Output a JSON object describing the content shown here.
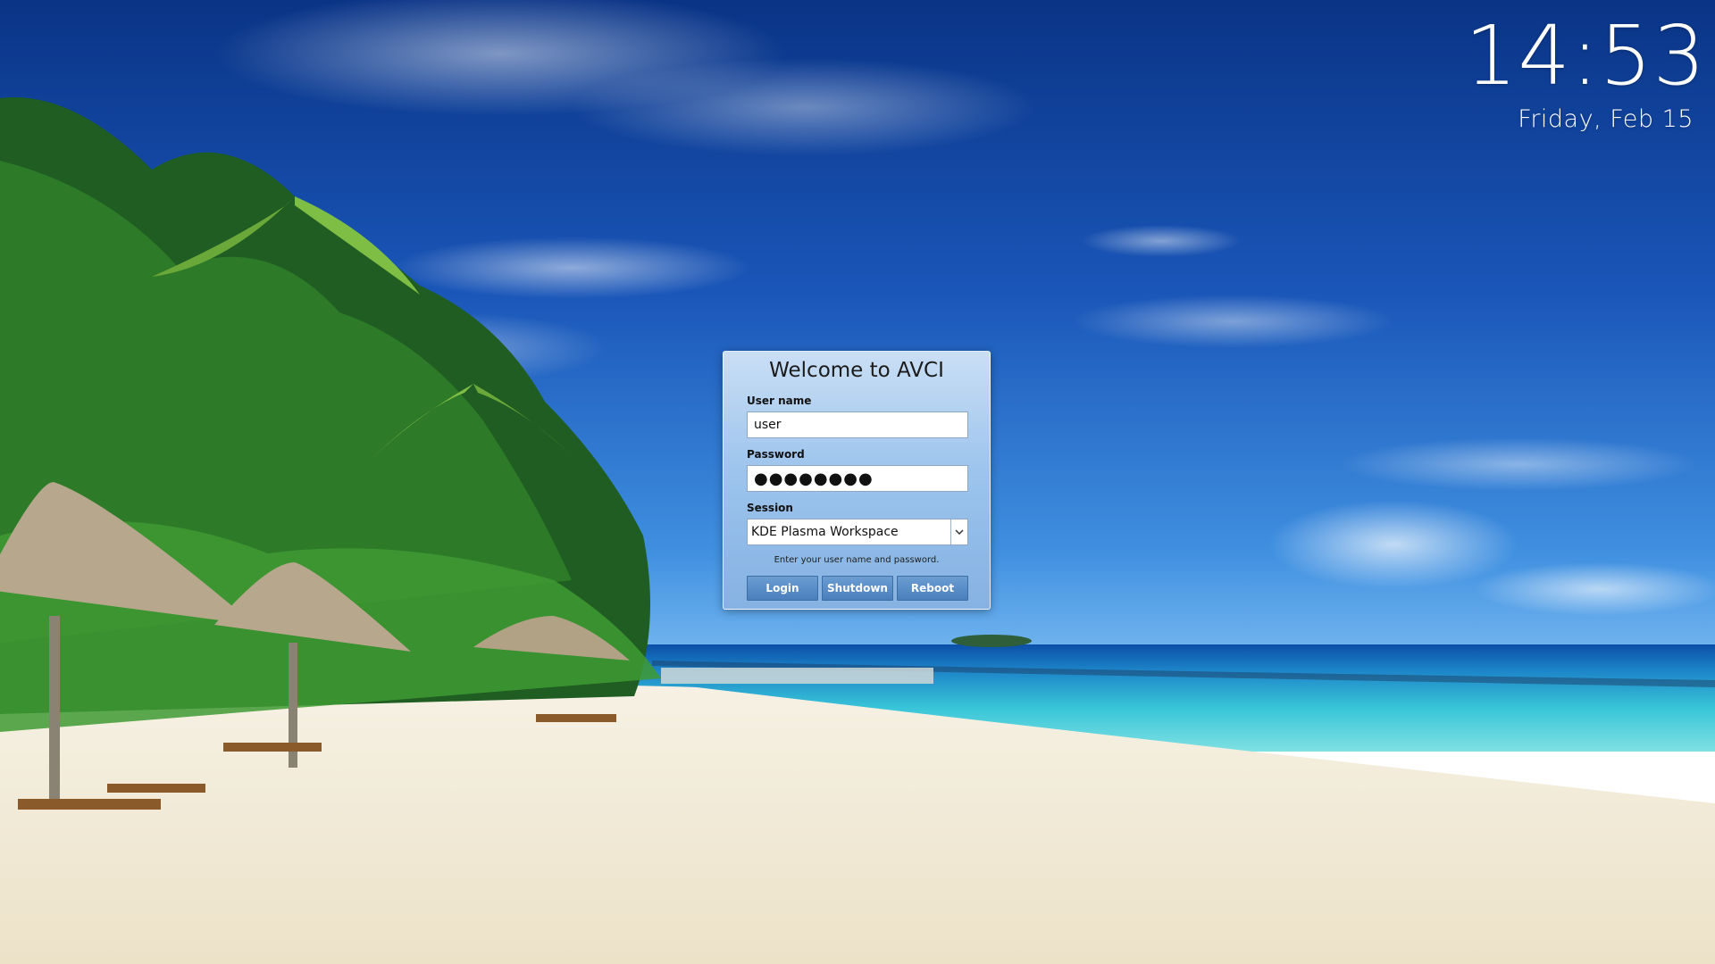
{
  "clock": {
    "time": "14:53",
    "date": "Friday, Feb 15"
  },
  "login": {
    "title": "Welcome to AVCI",
    "username_label": "User name",
    "username_value": "user",
    "password_label": "Password",
    "password_mask": "●●●●●●●●",
    "session_label": "Session",
    "session_value": "KDE Plasma Workspace",
    "hint": "Enter your user name and password.",
    "buttons": {
      "login": "Login",
      "shutdown": "Shutdown",
      "reboot": "Reboot"
    }
  },
  "colors": {
    "sky_top": "#0a3a8c",
    "sky_mid": "#1d63c4",
    "sea": "#34c3d6",
    "sand": "#f5efe0",
    "button": "#4a7fbd"
  },
  "icons": {
    "dropdown": "chevron-down-icon"
  }
}
